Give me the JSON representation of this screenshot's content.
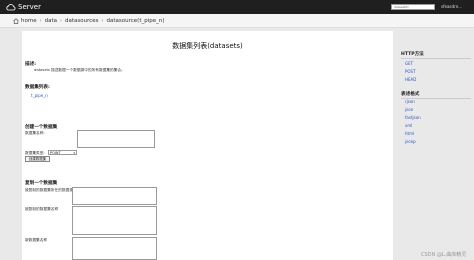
{
  "header": {
    "app_name": "Server",
    "search_placeholder": "datasetID",
    "user": "sfeasdrn..."
  },
  "breadcrumb": [
    "home",
    "data",
    "datasources",
    "datasource(t_pipe_n)"
  ],
  "main": {
    "title": "数据集列表(datasets)",
    "description": {
      "heading": "描述:",
      "text": "datasets 描述数据一个数据源中的所有数据集的集合。"
    },
    "dataset_list": {
      "heading": "数据集列表:",
      "items": [
        "t_pipe_n"
      ]
    },
    "create_dataset": {
      "heading": "创建一个数据集",
      "name_label": "数据集名称:",
      "type_label": "数据集类型:",
      "type_value": "POINT",
      "button": "创建数据集"
    },
    "copy_dataset": {
      "heading": "复制一个数据集",
      "field1_label": "被复制的数据集所在的数据源名",
      "field2_label": "被复制的数据集名称",
      "field3_label": "新数据集名称"
    }
  },
  "sidebar": {
    "http_methods": {
      "heading": "HTTP方法",
      "items": [
        "GET",
        "POST",
        "HEAD"
      ]
    },
    "formats": {
      "heading": "表述格式",
      "items": [
        "rjson",
        "json",
        "fastjson",
        "xml",
        "html",
        "jsonp"
      ]
    }
  },
  "watermark": "CSDN @L.曲库精灵"
}
